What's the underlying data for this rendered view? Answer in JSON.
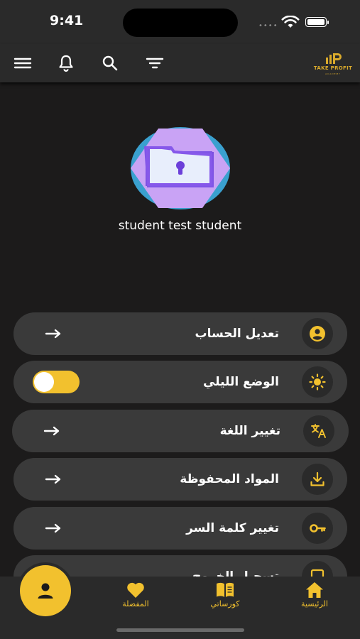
{
  "status_bar": {
    "time": "9:41"
  },
  "header": {
    "icons": [
      "menu-icon",
      "bell-icon",
      "search-icon",
      "filter-icon"
    ],
    "logo_text": "TAKE PROFIT",
    "logo_subtext": "ACADEMY"
  },
  "profile": {
    "name": "student test student"
  },
  "menu": {
    "edit_account": "تعديل الحساب",
    "night_mode": "الوضع الليلي",
    "change_language": "تغيير اللغة",
    "saved_materials": "المواد المحفوظة",
    "change_password": "تغيير كلمة السر",
    "partial_item": "تسجيل الخروج"
  },
  "night_mode_enabled": true,
  "bottom_nav": {
    "favorites": "المفضلة",
    "courses": "كورساتي",
    "home": "الرئيسية"
  },
  "colors": {
    "accent": "#f2c12e",
    "background": "#1c1b1b",
    "card": "#3a3a3a"
  }
}
